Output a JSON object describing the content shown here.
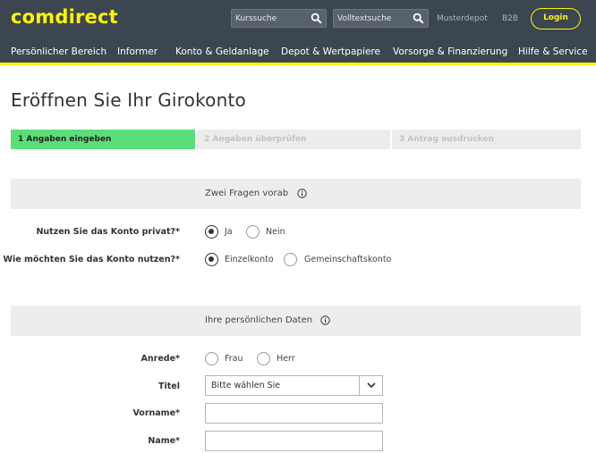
{
  "header": {
    "logo": "comdirect",
    "search_quotes_placeholder": "Kurssuche",
    "search_fulltext_placeholder": "Volltextsuche",
    "links": {
      "musterdepot": "Musterdepot",
      "b2b": "B2B"
    },
    "login_label": "Login",
    "accent_color": "#fff500",
    "bg_color": "#3c4650"
  },
  "nav": {
    "items": [
      "Persönlicher Bereich",
      "Informer",
      "Konto & Geldanlage",
      "Depot & Wertpapiere",
      "Vorsorge & Finanzierung",
      "Hilfe & Service"
    ]
  },
  "page": {
    "title": "Eröffnen Sie Ihr Girokonto"
  },
  "steps": [
    {
      "label": "1 Angaben eingeben",
      "state": "active"
    },
    {
      "label": "2 Angaben überprüfen",
      "state": "inactive"
    },
    {
      "label": "3 Antrag ausdrucken",
      "state": "inactive"
    }
  ],
  "step_active_color": "#5ade78",
  "section1": {
    "title": "Zwei Fragen vorab",
    "q1": {
      "label": "Nutzen Sie das Konto privat?*",
      "options": [
        "Ja",
        "Nein"
      ],
      "selected": "Ja"
    },
    "q2": {
      "label": "Wie möchten Sie das Konto nutzen?*",
      "options": [
        "Einzelkonto",
        "Gemeinschaftskonto"
      ],
      "selected": "Einzelkonto"
    }
  },
  "section2": {
    "title": "Ihre persönlichen Daten",
    "anrede": {
      "label": "Anrede*",
      "options": [
        "Frau",
        "Herr"
      ]
    },
    "titel": {
      "label": "Titel",
      "selected": "Bitte wählen Sie"
    },
    "vorname": {
      "label": "Vorname*",
      "value": ""
    },
    "name": {
      "label": "Name*",
      "value": ""
    }
  }
}
